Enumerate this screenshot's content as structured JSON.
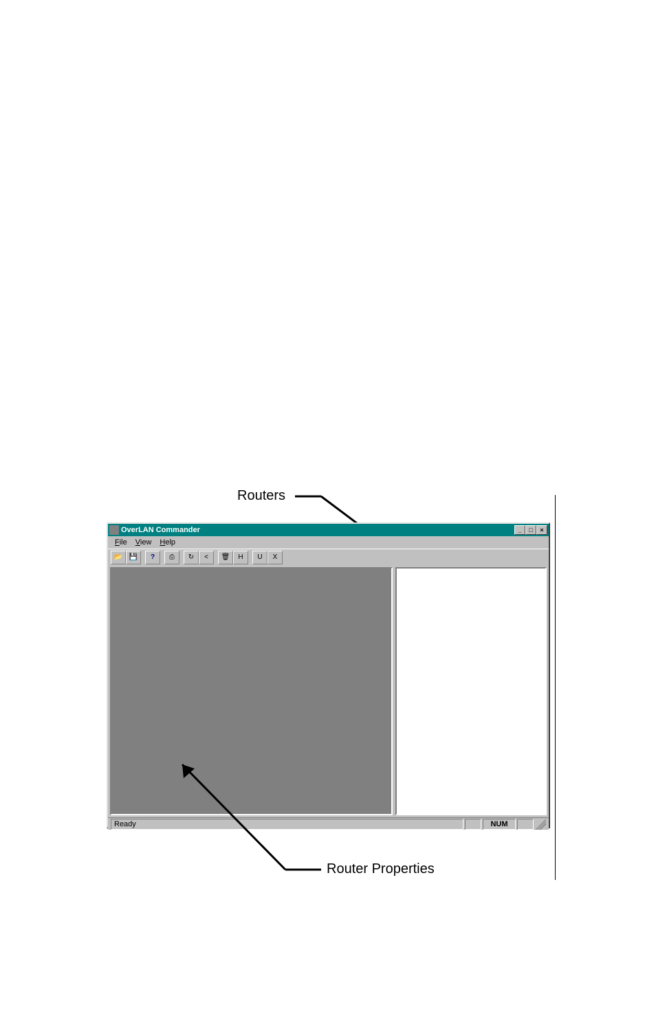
{
  "window": {
    "title": "OverLAN Commander"
  },
  "menubar": {
    "items": [
      {
        "label": "File",
        "underline": "F"
      },
      {
        "label": "View",
        "underline": "V"
      },
      {
        "label": "Help",
        "underline": "H"
      }
    ]
  },
  "toolbar": {
    "buttons": [
      {
        "name": "open-button",
        "icon": "📂"
      },
      {
        "name": "save-button",
        "icon": "💾"
      },
      {
        "name": "help-button",
        "icon": "?"
      },
      {
        "name": "print-button",
        "icon": "🖨"
      },
      {
        "name": "refresh-button",
        "icon": "↻"
      },
      {
        "name": "back-button",
        "icon": "<"
      },
      {
        "name": "delete-button",
        "icon": "🗑"
      },
      {
        "name": "properties-button",
        "icon": "H"
      },
      {
        "name": "up-button",
        "icon": "U"
      },
      {
        "name": "stop-button",
        "icon": "X"
      }
    ]
  },
  "statusbar": {
    "text": "Ready",
    "indicator": "NUM"
  },
  "annotations": {
    "routers": "Routers",
    "router_properties": "Router Properties"
  }
}
